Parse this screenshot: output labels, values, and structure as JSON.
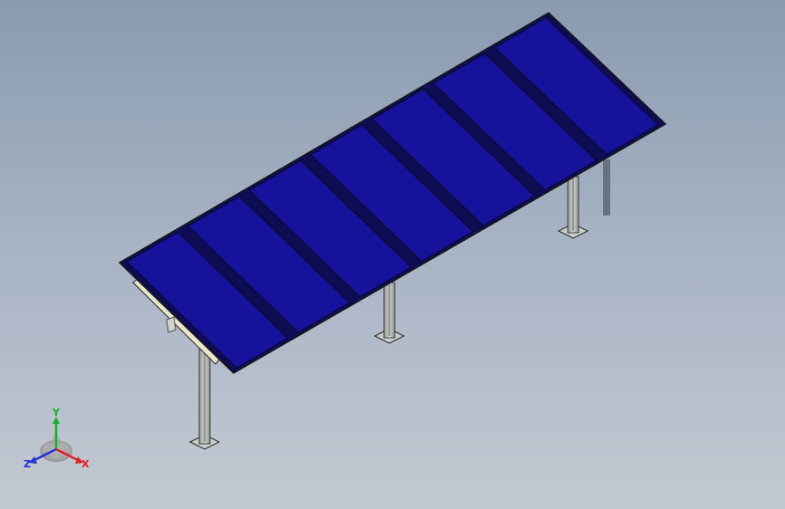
{
  "viewport": {
    "background_top": "#8a9aaf",
    "background_bottom": "#c3c9d2"
  },
  "model": {
    "panel_count": 7,
    "support_post_count": 3,
    "panel_color": "#16129a",
    "panel_edge_color": "#0a0a2a",
    "post_color": "#b9bdb9"
  },
  "triad": {
    "x_label": "X",
    "y_label": "Y",
    "z_label": "Z",
    "x_color": "#d8262a",
    "y_color": "#1fae2b",
    "z_color": "#2532d6"
  }
}
